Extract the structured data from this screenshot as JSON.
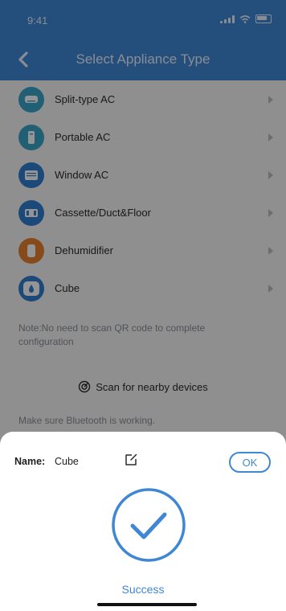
{
  "status_bar": {
    "time": "9:41"
  },
  "header": {
    "title": "Select Appliance Type"
  },
  "appliances": [
    {
      "label": "Split-type AC",
      "icon": "split-ac-icon",
      "color": "#3aa6c9"
    },
    {
      "label": "Portable AC",
      "icon": "portable-ac-icon",
      "color": "#3aa6c9"
    },
    {
      "label": "Window AC",
      "icon": "window-ac-icon",
      "color": "#2f7fd0"
    },
    {
      "label": "Cassette/Duct&Floor",
      "icon": "cassette-icon",
      "color": "#2f7fd0"
    },
    {
      "label": "Dehumidifier",
      "icon": "dehumidifier-icon",
      "color": "#e9822f"
    },
    {
      "label": "Cube",
      "icon": "cube-icon",
      "color": "#2f7fd0"
    }
  ],
  "note": "Note:No need to scan QR code to complete configuration",
  "scan": {
    "label": "Scan for nearby devices"
  },
  "bluetooth_note": "Make sure Bluetooth is working.",
  "sheet": {
    "name_label": "Name:",
    "name_value": "Cube",
    "ok_label": "OK",
    "status": "Success"
  },
  "colors": {
    "accent": "#3f87d5",
    "overlay": "rgba(0,0,0,0.42)"
  }
}
